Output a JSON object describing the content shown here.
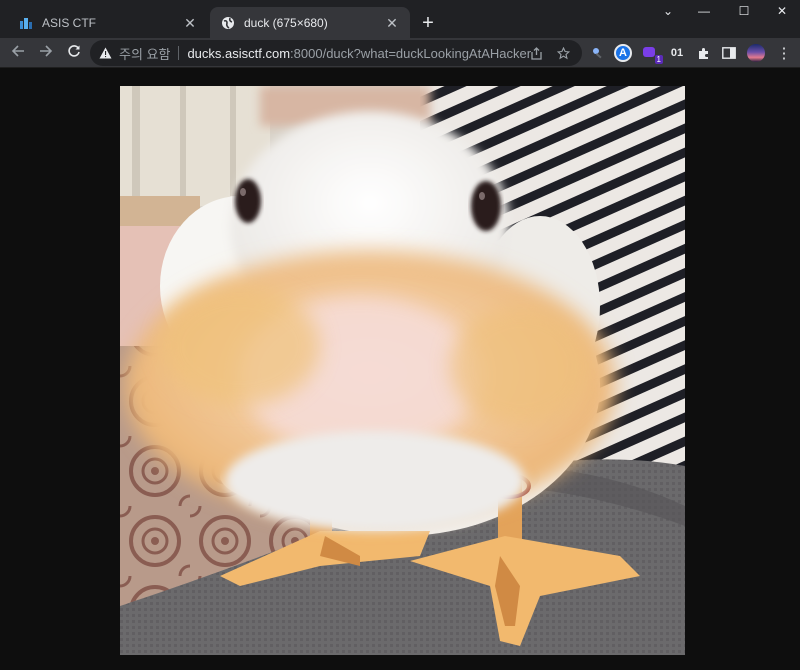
{
  "browser": {
    "tabs": [
      {
        "title": "ASIS CTF",
        "active": false
      },
      {
        "title": "duck (675×680)",
        "active": true
      }
    ],
    "new_tab_label": "+",
    "window_controls": {
      "minimize": "—",
      "maximize": "☐",
      "close": "✕",
      "chevron": "⌄"
    },
    "security_label": "주의 요함",
    "url_host": "ducks.asisctf.com",
    "url_rest": ":8000/duck?what=duckLookingAtAHacker",
    "extensions": {
      "profile_letter": "A",
      "badge_count": "1",
      "ext_01": "01"
    }
  },
  "page": {
    "image_alt": "duck",
    "image_name": "duck"
  }
}
